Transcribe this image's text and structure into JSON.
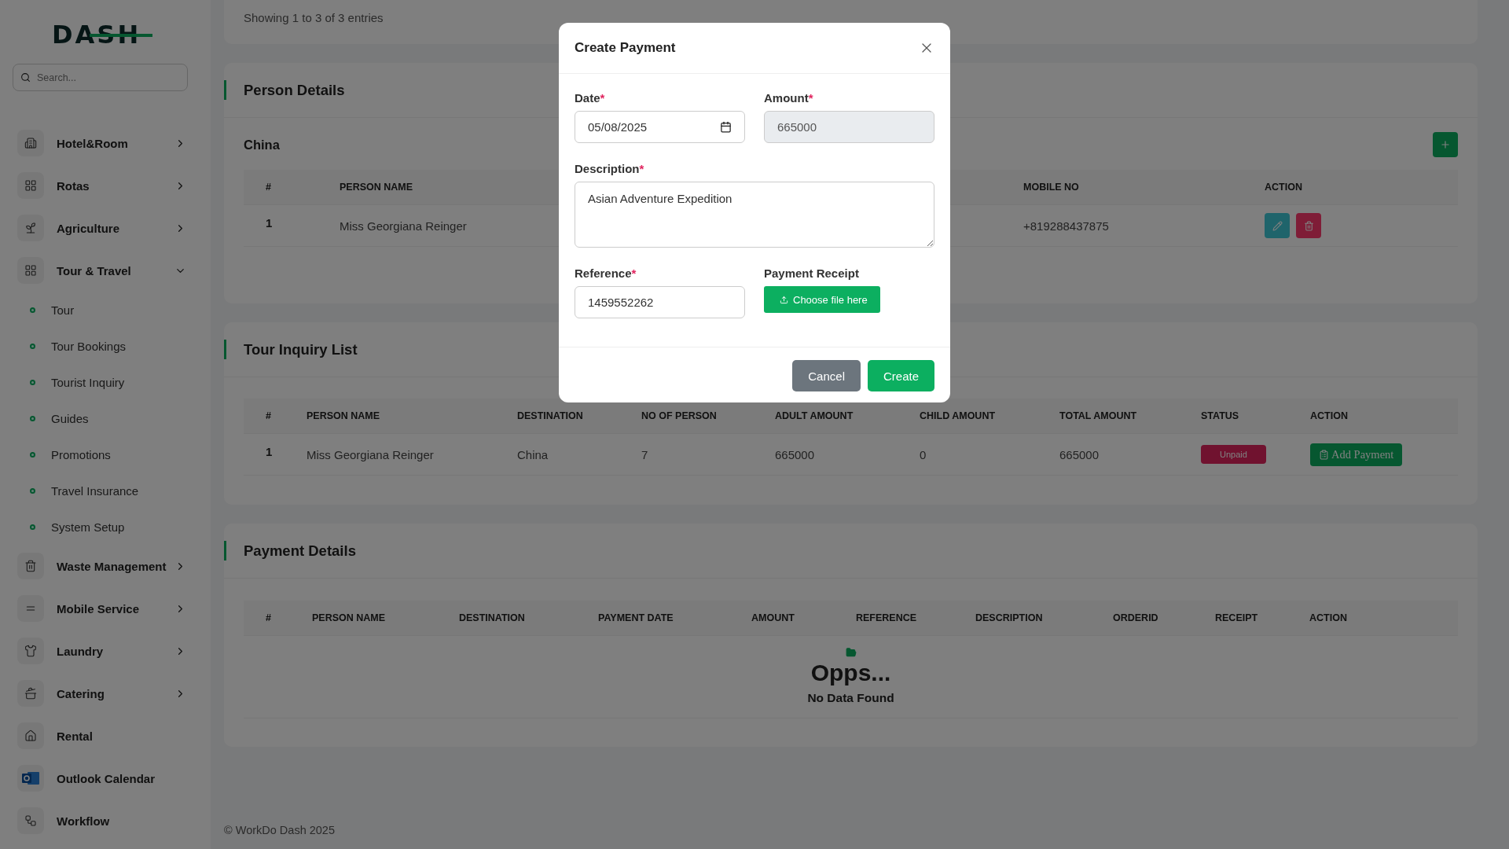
{
  "sidebar": {
    "logo": "DASH",
    "search": {
      "placeholder": "Search..."
    },
    "items": [
      {
        "label": "Hotel&Room",
        "kind": "group",
        "expanded": false
      },
      {
        "label": "Rotas",
        "kind": "group",
        "expanded": false
      },
      {
        "label": "Agriculture",
        "kind": "group",
        "expanded": false
      },
      {
        "label": "Tour & Travel",
        "kind": "group",
        "expanded": true,
        "children": [
          {
            "label": "Tour"
          },
          {
            "label": "Tour Bookings"
          },
          {
            "label": "Tourist Inquiry"
          },
          {
            "label": "Guides"
          },
          {
            "label": "Promotions"
          },
          {
            "label": "Travel Insurance"
          },
          {
            "label": "System Setup"
          }
        ]
      },
      {
        "label": "Waste Management",
        "kind": "group",
        "expanded": false
      },
      {
        "label": "Mobile Service",
        "kind": "group",
        "expanded": false
      },
      {
        "label": "Laundry",
        "kind": "group",
        "expanded": false
      },
      {
        "label": "Catering",
        "kind": "group",
        "expanded": false
      },
      {
        "label": "Rental",
        "kind": "link"
      },
      {
        "label": "Outlook Calendar",
        "kind": "link"
      },
      {
        "label": "Workflow",
        "kind": "link"
      }
    ]
  },
  "entries_info": "Showing 1 to 3 of 3 entries",
  "person_details": {
    "title": "Person Details",
    "group": "China",
    "columns": [
      "#",
      "PERSON NAME",
      "MOBILE NO",
      "ACTION"
    ],
    "rows": [
      {
        "cells": [
          "1",
          "Miss Georgiana Reinger",
          "+819288437875"
        ]
      }
    ]
  },
  "tour_inquiry": {
    "title": "Tour Inquiry List",
    "columns": [
      "#",
      "PERSON NAME",
      "DESTINATION",
      "NO OF PERSON",
      "ADULT AMOUNT",
      "CHILD AMOUNT",
      "TOTAL AMOUNT",
      "STATUS",
      "ACTION"
    ],
    "rows": [
      {
        "cells": [
          "1",
          "Miss Georgiana Reinger",
          "China",
          "7",
          "665000",
          "0",
          "665000"
        ],
        "status": {
          "text": "Unpaid",
          "kind": "unpaid"
        },
        "action": "Add Payment"
      }
    ]
  },
  "payment_details": {
    "title": "Payment Details",
    "columns": [
      "#",
      "PERSON NAME",
      "DESTINATION",
      "PAYMENT DATE",
      "AMOUNT",
      "REFERENCE",
      "DESCRIPTION",
      "ORDERID",
      "RECEIPT",
      "ACTION"
    ],
    "empty": {
      "title": "Opps...",
      "message": "No Data Found"
    }
  },
  "footer": "© WorkDo Dash 2025",
  "modal": {
    "title": "Create Payment",
    "required_mark": "*",
    "fields": [
      {
        "kind": "date",
        "label": "Date",
        "required": true,
        "value": "05/08/2025",
        "readonly": false
      },
      {
        "kind": "text",
        "label": "Amount",
        "required": true,
        "value": "665000",
        "readonly": true
      },
      {
        "kind": "textarea",
        "label": "Description",
        "required": true,
        "value": "Asian Adventure Expedition"
      },
      {
        "kind": "text",
        "label": "Reference",
        "required": true,
        "value": "1459552262",
        "readonly": false
      },
      {
        "kind": "file",
        "label": "Payment Receipt",
        "required": false,
        "button": "Choose file here"
      }
    ],
    "buttons": [
      {
        "label": "Cancel",
        "kind": "secondary"
      },
      {
        "label": "Create",
        "kind": "primary"
      }
    ]
  }
}
